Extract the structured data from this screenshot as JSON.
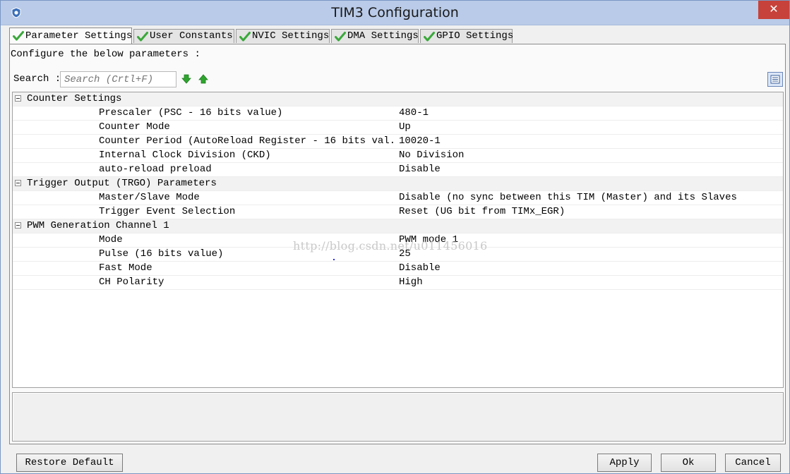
{
  "window": {
    "title": "TIM3 Configuration",
    "close_glyph": "✕"
  },
  "tabs": [
    {
      "label": "Parameter Settings",
      "active": true
    },
    {
      "label": "User Constants",
      "active": false
    },
    {
      "label": "NVIC Settings",
      "active": false
    },
    {
      "label": "DMA Settings",
      "active": false
    },
    {
      "label": "GPIO Settings",
      "active": false
    }
  ],
  "configure_text": "Configure the below parameters :",
  "search": {
    "label": "Search :",
    "placeholder": "Search (Crtl+F)"
  },
  "groups": [
    {
      "label": "Counter Settings",
      "params": [
        {
          "name": "Prescaler (PSC - 16 bits value)",
          "value": "480-1"
        },
        {
          "name": "Counter Mode",
          "value": "Up"
        },
        {
          "name": "Counter Period (AutoReload Register - 16 bits val...",
          "value": "10020-1"
        },
        {
          "name": "Internal Clock Division (CKD)",
          "value": "No Division"
        },
        {
          "name": "auto-reload preload",
          "value": "Disable"
        }
      ]
    },
    {
      "label": "Trigger Output (TRGO) Parameters",
      "params": [
        {
          "name": "Master/Slave Mode",
          "value": "Disable (no sync between this TIM (Master) and its Slaves"
        },
        {
          "name": "Trigger Event Selection",
          "value": "Reset (UG bit from TIMx_EGR)"
        }
      ]
    },
    {
      "label": "PWM Generation Channel 1",
      "params": [
        {
          "name": "Mode",
          "value": "PWM mode 1"
        },
        {
          "name": "Pulse (16 bits value)",
          "value": "25"
        },
        {
          "name": "Fast Mode",
          "value": "Disable"
        },
        {
          "name": "CH Polarity",
          "value": "High"
        }
      ]
    }
  ],
  "watermark": "http://blog.csdn.net/u011456016",
  "buttons": {
    "restore": "Restore Default",
    "apply": "Apply",
    "ok": "Ok",
    "cancel": "Cancel"
  },
  "colors": {
    "title_bar": "#b9cbe8",
    "close": "#c7423a",
    "check_green": "#3aa83a",
    "arrow_green": "#2fa52f"
  },
  "icons": {
    "tab_status": "check-icon",
    "search_next": "arrow-down-icon",
    "search_prev": "arrow-up-icon",
    "view_toggle": "list-view-icon"
  }
}
